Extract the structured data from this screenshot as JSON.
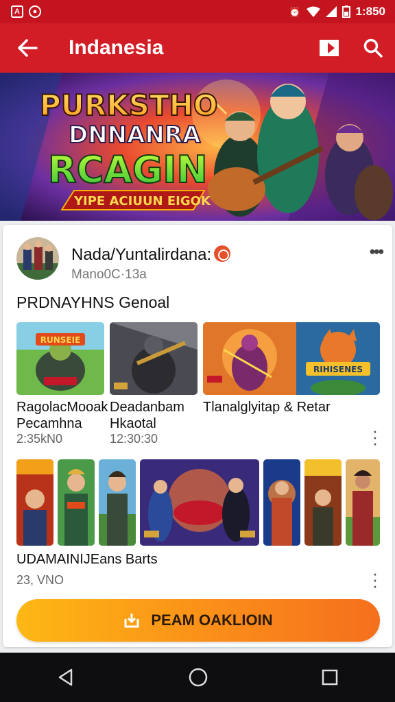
{
  "status_bar": {
    "time": "1:850"
  },
  "header": {
    "title": "Indanesia"
  },
  "banner": {
    "line1": "PURKSTHO",
    "line2": "DNNANRA",
    "line3": "RCAGIN",
    "ribbon": "YIPE ACIUUN EIGOK"
  },
  "post": {
    "author": "Nada/Yuntalirdana:",
    "author_sub": "Mano0C·13a",
    "title": "PRDNAYHNS Genoal",
    "items": [
      {
        "caption_line1": "RagolacMooak",
        "caption_line2": "Pecamhna",
        "meta": "2:35kN0"
      },
      {
        "caption_line1": "Deadanbam",
        "caption_line2": "Hkaotal",
        "meta": "12:30:30"
      },
      {
        "caption_line1": "Tlanalglyitap & Retar",
        "caption_line2": "",
        "meta": ""
      }
    ],
    "section2": {
      "caption": "UDAMAINIJEans Barts",
      "meta": "23, VNO"
    },
    "thumb_labels": [
      "RUNSEIE",
      "RIHISENES"
    ],
    "download_label": "PEAM OAKLIOIN"
  },
  "colors": {
    "status_bar": "#c4141f",
    "app_bar": "#d21d26",
    "button_start": "#fdb813",
    "button_end": "#f56f1d",
    "nav_bar": "#0e0e10"
  },
  "icons": [
    "back-arrow-icon",
    "cast-icon",
    "search-icon",
    "more-icon",
    "download-icon",
    "nav-back-icon",
    "nav-home-icon",
    "nav-recents-icon"
  ]
}
